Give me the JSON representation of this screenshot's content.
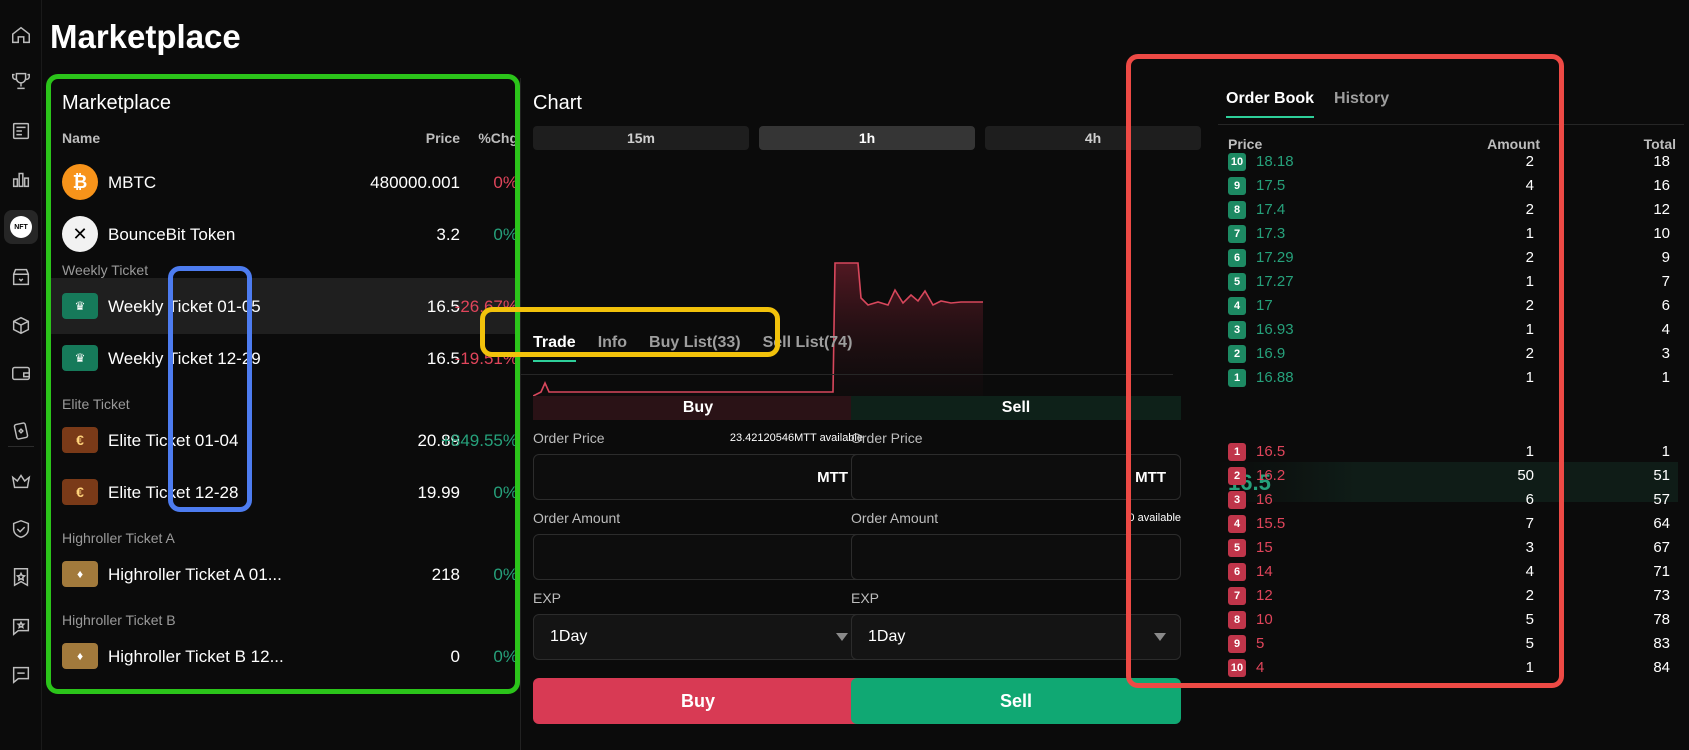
{
  "page": {
    "title": "Marketplace"
  },
  "rail": {
    "items": [
      "home-icon",
      "trophy-icon",
      "news-icon",
      "bar-chart-icon",
      "nft-icon",
      "store-icon",
      "box-icon",
      "wallet-icon",
      "cards-icon",
      "crown-icon",
      "shield-icon",
      "badge-star-icon",
      "chat-star-icon",
      "chat-icon"
    ],
    "nft_label": "NFT"
  },
  "market": {
    "title": "Marketplace",
    "headers": {
      "name": "Name",
      "price": "Price",
      "chg": "%Chg"
    },
    "rows": [
      {
        "name": "MBTC",
        "price": "480000.001",
        "chg": "0%"
      },
      {
        "name": "BounceBit Token",
        "price": "3.2",
        "chg": "0%"
      },
      {
        "name": "Weekly Ticket 01-05",
        "price": "16.5",
        "chg": "-26.67%"
      },
      {
        "name": "Weekly Ticket 12-29",
        "price": "16.5",
        "chg": "-19.51%"
      },
      {
        "name": "Elite Ticket 01-04",
        "price": "20.89",
        "chg": "+849.55%"
      },
      {
        "name": "Elite Ticket 12-28",
        "price": "19.99",
        "chg": "0%"
      },
      {
        "name": "Highroller Ticket A 01...",
        "price": "218",
        "chg": "0%"
      },
      {
        "name": "Highroller Ticket B 12...",
        "price": "0",
        "chg": "0%"
      }
    ],
    "groups": [
      "Weekly Ticket",
      "Elite Ticket",
      "Highroller Ticket A",
      "Highroller Ticket B"
    ]
  },
  "chart": {
    "title": "Chart",
    "timeframes": [
      "15m",
      "1h",
      "4h"
    ],
    "selected_timeframe": "1h"
  },
  "trade_tabs": [
    "Trade",
    "Info",
    "Buy List(33)",
    "Sell List(74)"
  ],
  "buy": {
    "header": "Buy",
    "price_label": "Order Price",
    "available": "23.42120546MTT available",
    "price_unit": "MTT",
    "amount_label": "Order Amount",
    "exp_label": "EXP",
    "exp_value": "1Day",
    "button": "Buy"
  },
  "sell": {
    "header": "Sell",
    "price_label": "Order Price",
    "price_unit": "MTT",
    "amount_label": "Order Amount",
    "available": "0 available",
    "exp_label": "EXP",
    "exp_value": "1Day",
    "button": "Sell"
  },
  "orderbook": {
    "tabs": [
      "Order Book",
      "History"
    ],
    "headers": {
      "price": "Price",
      "amount": "Amount",
      "total": "Total"
    },
    "asks": [
      {
        "n": "10",
        "price": "18.18",
        "amount": "2",
        "total": "18"
      },
      {
        "n": "9",
        "price": "17.5",
        "amount": "4",
        "total": "16"
      },
      {
        "n": "8",
        "price": "17.4",
        "amount": "2",
        "total": "12"
      },
      {
        "n": "7",
        "price": "17.3",
        "amount": "1",
        "total": "10"
      },
      {
        "n": "6",
        "price": "17.29",
        "amount": "2",
        "total": "9"
      },
      {
        "n": "5",
        "price": "17.27",
        "amount": "1",
        "total": "7"
      },
      {
        "n": "4",
        "price": "17",
        "amount": "2",
        "total": "6"
      },
      {
        "n": "3",
        "price": "16.93",
        "amount": "1",
        "total": "4"
      },
      {
        "n": "2",
        "price": "16.9",
        "amount": "2",
        "total": "3"
      },
      {
        "n": "1",
        "price": "16.88",
        "amount": "1",
        "total": "1"
      }
    ],
    "last_price": "16.5",
    "bids": [
      {
        "n": "1",
        "price": "16.5",
        "amount": "1",
        "total": "1"
      },
      {
        "n": "2",
        "price": "16.2",
        "amount": "50",
        "total": "51"
      },
      {
        "n": "3",
        "price": "16",
        "amount": "6",
        "total": "57"
      },
      {
        "n": "4",
        "price": "15.5",
        "amount": "7",
        "total": "64"
      },
      {
        "n": "5",
        "price": "15",
        "amount": "3",
        "total": "67"
      },
      {
        "n": "6",
        "price": "14",
        "amount": "4",
        "total": "71"
      },
      {
        "n": "7",
        "price": "12",
        "amount": "2",
        "total": "73"
      },
      {
        "n": "8",
        "price": "10",
        "amount": "5",
        "total": "78"
      },
      {
        "n": "9",
        "price": "5",
        "amount": "5",
        "total": "83"
      },
      {
        "n": "10",
        "price": "4",
        "amount": "1",
        "total": "84"
      }
    ]
  },
  "colors": {
    "green": "#26a17b",
    "red": "#e0455b",
    "highlight_green": "#2bc41a",
    "highlight_blue": "#4d7cf0",
    "highlight_yellow": "#f2c20b",
    "highlight_red": "#ee4a45"
  }
}
